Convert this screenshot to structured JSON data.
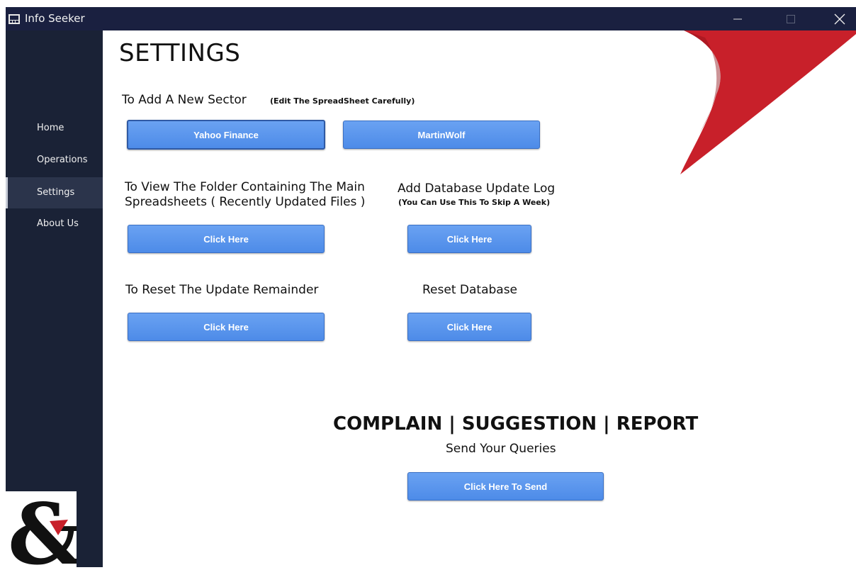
{
  "window": {
    "title": "Info Seeker",
    "icons": {
      "app": "app-icon",
      "minimize": "minimize-icon",
      "maximize": "maximize-icon",
      "close": "close-icon"
    }
  },
  "sidebar": {
    "items": [
      {
        "label": "Home",
        "active": false
      },
      {
        "label": "Operations",
        "active": false
      },
      {
        "label": "Settings",
        "active": true
      },
      {
        "label": "About Us",
        "active": false
      }
    ]
  },
  "main": {
    "title": "SETTINGS",
    "add_sector": {
      "heading": "To Add A New Sector",
      "note": "(Edit The SpreadSheet Carefully)",
      "buttons": [
        "Yahoo Finance",
        "MartinWolf"
      ]
    },
    "view_folder": {
      "heading_line1": "To View The Folder Containing The Main",
      "heading_line2": "Spreadsheets ( Recently Updated Files )",
      "button": "Click Here"
    },
    "update_log": {
      "heading": "Add Database Update Log",
      "note": "(You Can Use This To Skip A Week)",
      "button": "Click Here"
    },
    "reset_reminder": {
      "heading": "To Reset The Update Remainder",
      "button": "Click Here"
    },
    "reset_database": {
      "heading": "Reset Database",
      "button": "Click Here"
    },
    "feedback": {
      "heading": "COMPLAIN | SUGGESTION | REPORT",
      "subheading": "Send Your Queries",
      "button": "Click Here To Send"
    }
  },
  "colors": {
    "titlebar": "#1a2040",
    "sidebar": "#1a2236",
    "sidebar_active": "#2b344b",
    "button": "#5a96ee",
    "accent_red": "#c8202a"
  }
}
